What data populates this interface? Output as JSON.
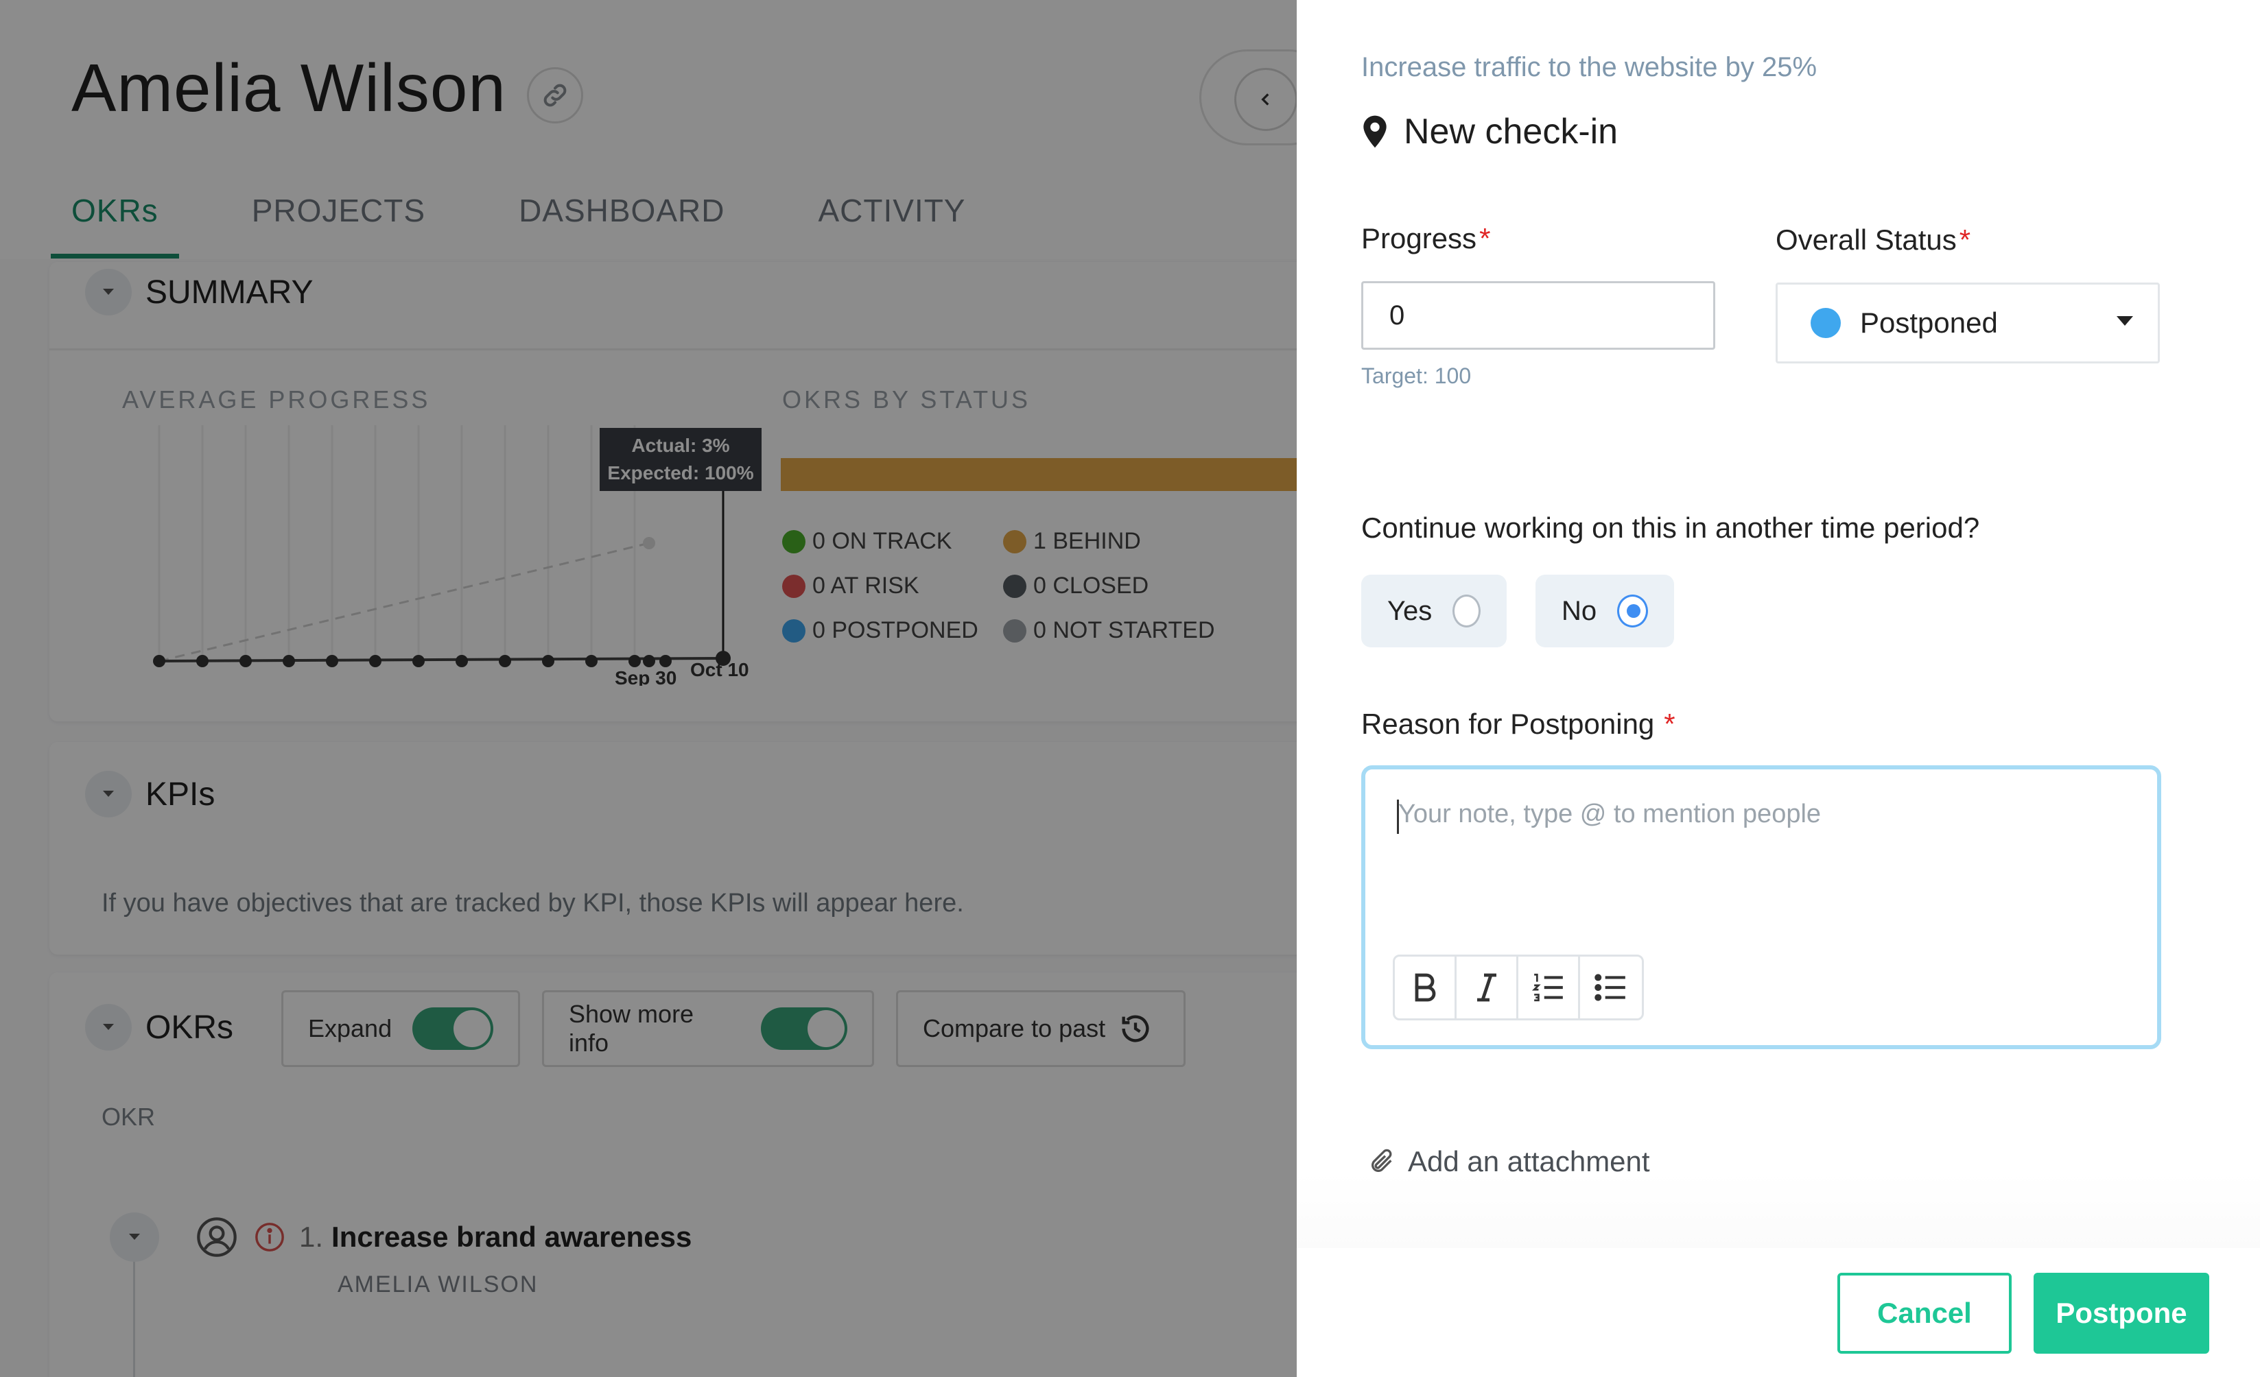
{
  "person": {
    "name": "Amelia Wilson"
  },
  "tabs": [
    "OKRs",
    "PROJECTS",
    "DASHBOARD",
    "ACTIVITY"
  ],
  "summary": {
    "title": "SUMMARY",
    "avg_progress_label": "AVERAGE PROGRESS",
    "okrs_by_status_label": "OKRS BY STATUS",
    "tooltip_actual": "Actual: 3%",
    "tooltip_expected": "Expected: 100%",
    "x_tick_1": "Sep 30",
    "x_tick_2": "Oct 10",
    "legend": [
      {
        "label": "0 ON TRACK",
        "color": "#4caf2a"
      },
      {
        "label": "1 BEHIND",
        "color": "#e3a84a"
      },
      {
        "label": "0 AT RISK",
        "color": "#e05353"
      },
      {
        "label": "0 CLOSED",
        "color": "#555b62"
      },
      {
        "label": "0 POSTPONED",
        "color": "#3fa7ee"
      },
      {
        "label": "0 NOT STARTED",
        "color": "#9ea4aa"
      }
    ]
  },
  "kpis": {
    "title": "KPIs",
    "empty_text": "If you have objectives that are tracked by KPI, those KPIs will appear here."
  },
  "okrs": {
    "title": "OKRs",
    "expand_label": "Expand",
    "show_more_label": "Show more info",
    "compare_label": "Compare to past",
    "column_label": "OKR",
    "item_number": "1.",
    "item_title": "Increase brand awareness",
    "item_owner": "AMELIA WILSON"
  },
  "panel": {
    "kr_title": "Increase traffic to the website by 25%",
    "checkin_title": "New check-in",
    "progress_label": "Progress",
    "progress_value": "0",
    "target_text": "Target: 100",
    "status_label": "Overall Status",
    "status_value": "Postponed",
    "question": "Continue working on this in another time period?",
    "yes_label": "Yes",
    "no_label": "No",
    "selected": "No",
    "reason_label": "Reason for Postponing",
    "note_placeholder": "Your note, type @ to mention people",
    "attach_label": "Add an attachment",
    "cancel_label": "Cancel",
    "postpone_label": "Postpone",
    "required_mark": "*"
  },
  "colors": {
    "accent_green": "#1ec796",
    "tab_active": "#1a8f6a",
    "postponed_blue": "#3fa7ee",
    "radio_blue": "#3f8ef2",
    "note_border": "#a6dbf5"
  }
}
